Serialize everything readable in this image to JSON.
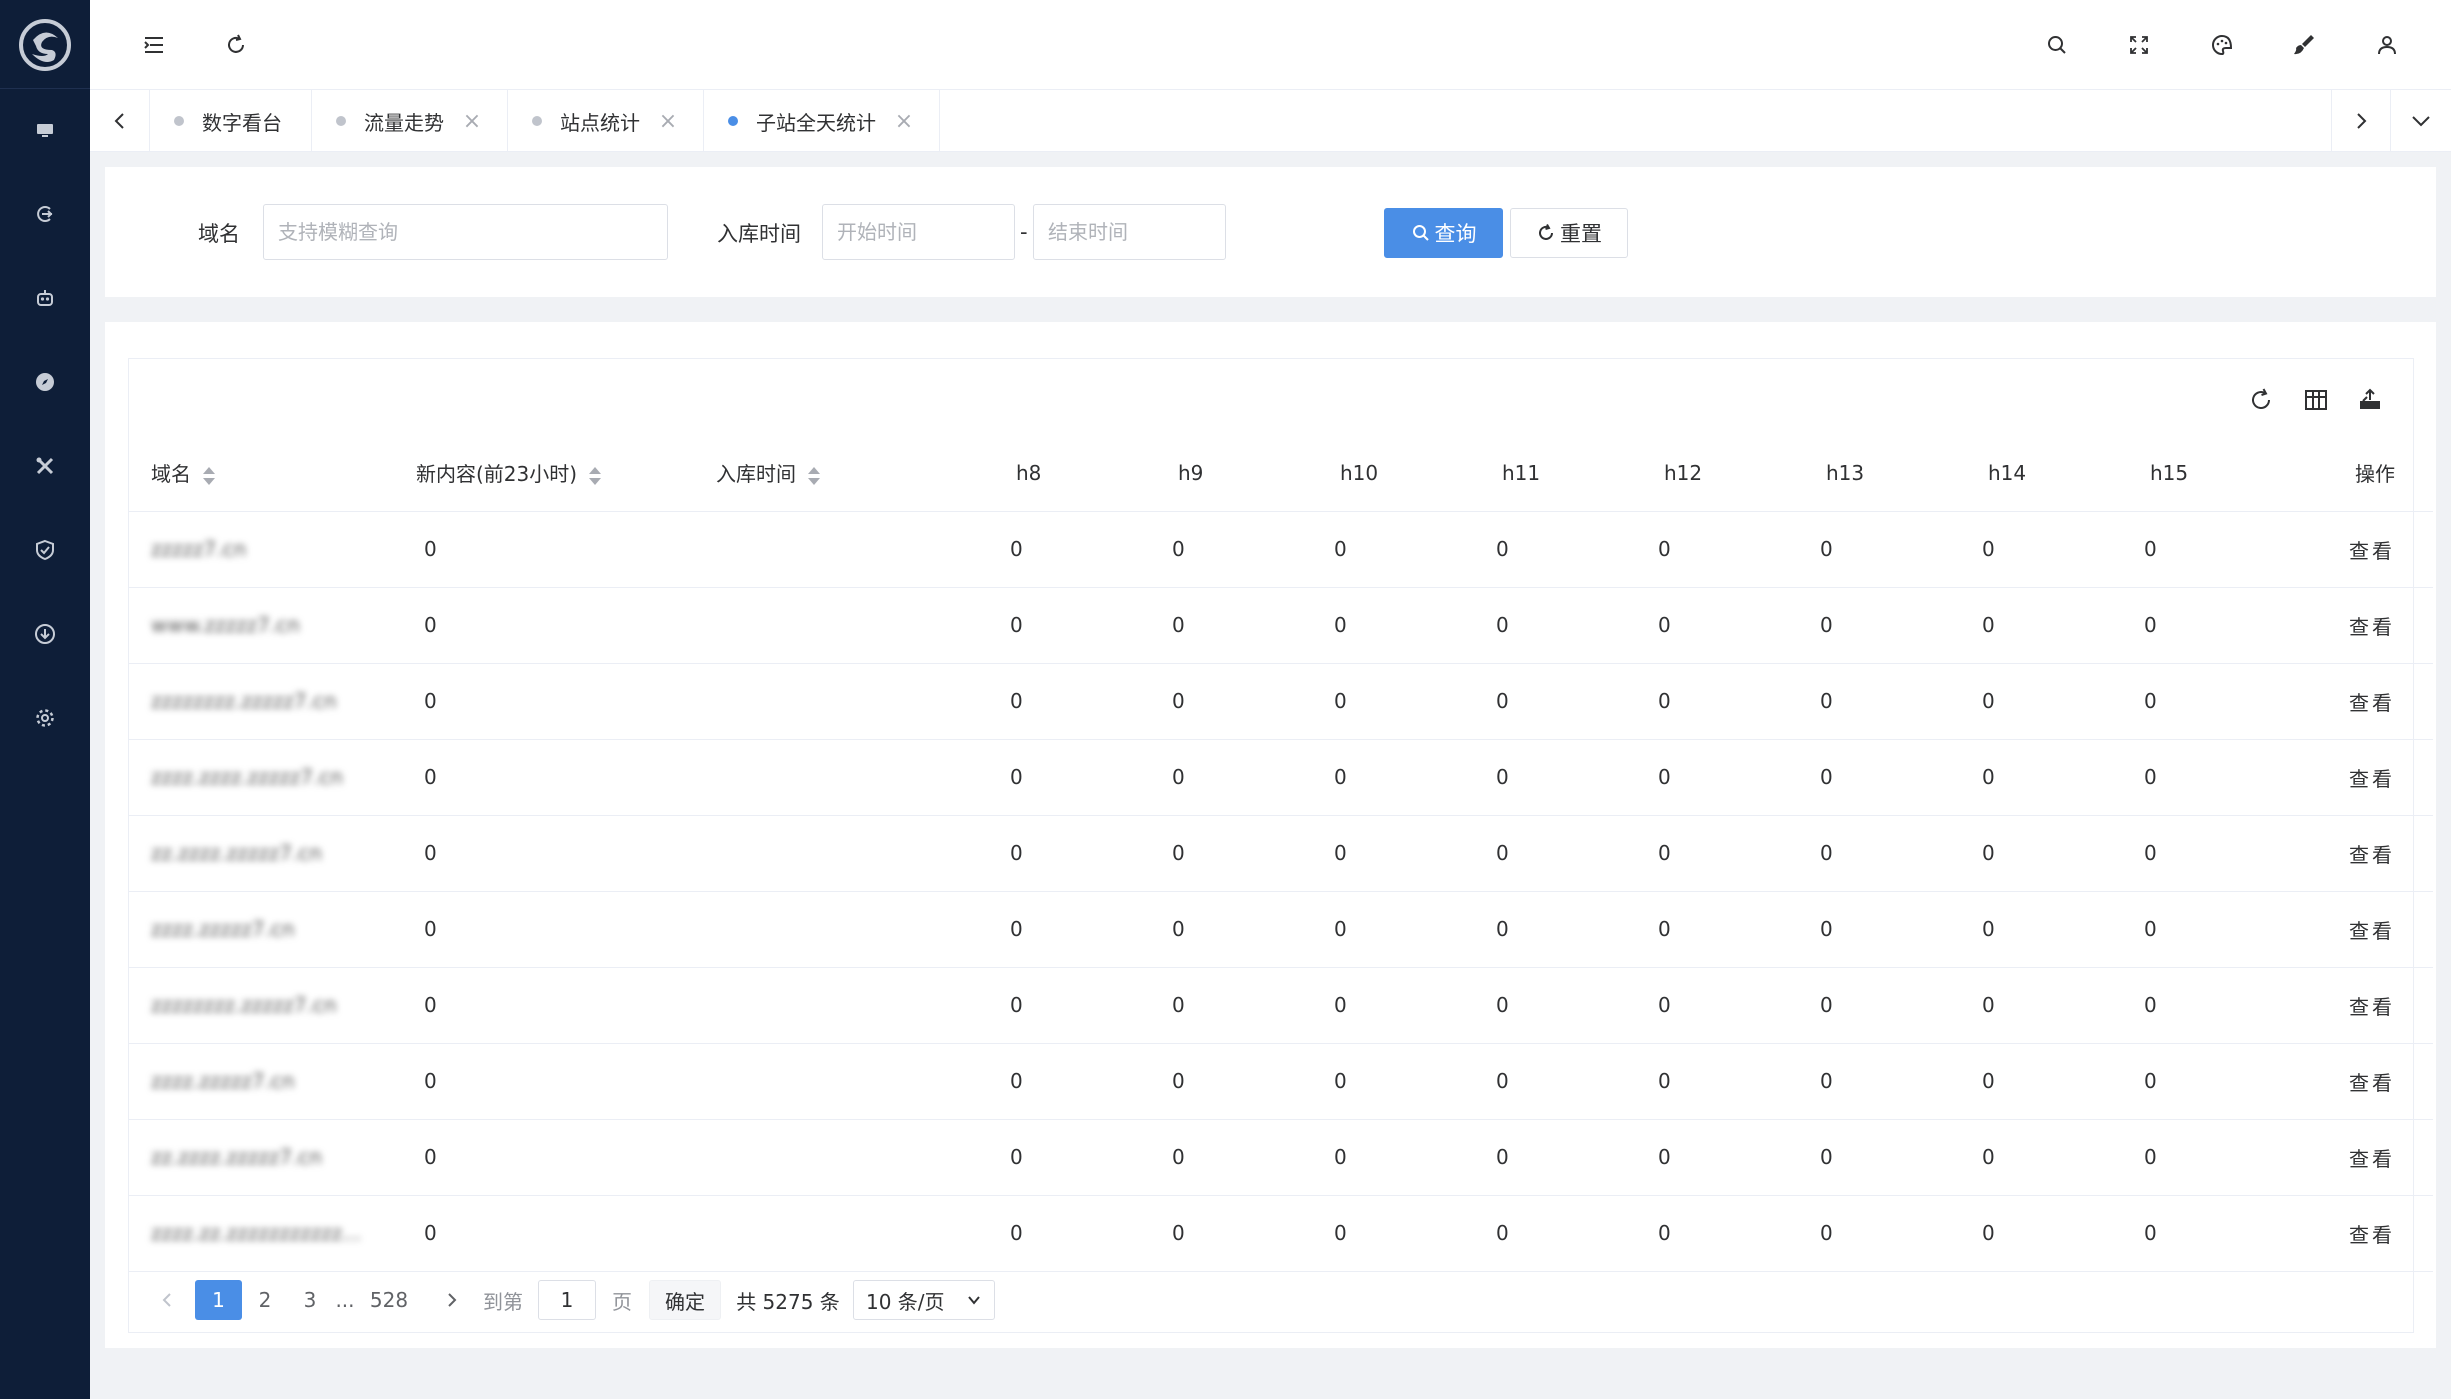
{
  "sidebar": {
    "logo": "logo-icon",
    "items": [
      {
        "name": "sidebar-item-monitor",
        "icon": "monitor-icon"
      },
      {
        "name": "sidebar-item-login",
        "icon": "login-icon"
      },
      {
        "name": "sidebar-item-robot",
        "icon": "robot-icon"
      },
      {
        "name": "sidebar-item-compass",
        "icon": "compass-icon"
      },
      {
        "name": "sidebar-item-tools",
        "icon": "tools-icon"
      },
      {
        "name": "sidebar-item-security",
        "icon": "shield-icon"
      },
      {
        "name": "sidebar-item-download",
        "icon": "download-icon"
      },
      {
        "name": "sidebar-item-settings",
        "icon": "gear-icon"
      }
    ]
  },
  "header": {
    "icons": [
      "menu-fold-icon",
      "refresh-icon",
      "search-icon",
      "fullscreen-icon",
      "palette-icon",
      "brush-icon",
      "user-icon"
    ]
  },
  "tabs": [
    {
      "label": "数字看台",
      "closable": false,
      "active": false
    },
    {
      "label": "流量走势",
      "closable": true,
      "active": false
    },
    {
      "label": "站点统计",
      "closable": true,
      "active": false
    },
    {
      "label": "子站全天统计",
      "closable": true,
      "active": true
    }
  ],
  "search": {
    "domain_label": "域名",
    "domain_placeholder": "支持模糊查询",
    "time_label": "入库时间",
    "start_placeholder": "开始时间",
    "separator": "-",
    "end_placeholder": "结束时间",
    "query_label": "查询",
    "reset_label": "重置"
  },
  "table": {
    "columns": [
      "域名",
      "新内容(前23小时)",
      "入库时间",
      "h8",
      "h9",
      "h10",
      "h11",
      "h12",
      "h13",
      "h14",
      "h15",
      "操作"
    ],
    "rows": [
      {
        "domain": "zzzzz7.cn",
        "new": "0",
        "time": "",
        "h": [
          "0",
          "0",
          "0",
          "0",
          "0",
          "0",
          "0",
          "0"
        ],
        "op": "查看"
      },
      {
        "domain": "www.zzzzz7.cn",
        "new": "0",
        "time": "",
        "h": [
          "0",
          "0",
          "0",
          "0",
          "0",
          "0",
          "0",
          "0"
        ],
        "op": "查看"
      },
      {
        "domain": "zzzzzzzz.zzzzz7.cn",
        "new": "0",
        "time": "",
        "h": [
          "0",
          "0",
          "0",
          "0",
          "0",
          "0",
          "0",
          "0"
        ],
        "op": "查看"
      },
      {
        "domain": "zzzz.zzzz.zzzzz7.cn",
        "new": "0",
        "time": "",
        "h": [
          "0",
          "0",
          "0",
          "0",
          "0",
          "0",
          "0",
          "0"
        ],
        "op": "查看"
      },
      {
        "domain": "zz.zzzz.zzzzz7.cn",
        "new": "0",
        "time": "",
        "h": [
          "0",
          "0",
          "0",
          "0",
          "0",
          "0",
          "0",
          "0"
        ],
        "op": "查看"
      },
      {
        "domain": "zzzz.zzzzz7.cn",
        "new": "0",
        "time": "",
        "h": [
          "0",
          "0",
          "0",
          "0",
          "0",
          "0",
          "0",
          "0"
        ],
        "op": "查看"
      },
      {
        "domain": "zzzzzzzz.zzzzz7.cn",
        "new": "0",
        "time": "",
        "h": [
          "0",
          "0",
          "0",
          "0",
          "0",
          "0",
          "0",
          "0"
        ],
        "op": "查看"
      },
      {
        "domain": "zzzz.zzzzz7.cn",
        "new": "0",
        "time": "",
        "h": [
          "0",
          "0",
          "0",
          "0",
          "0",
          "0",
          "0",
          "0"
        ],
        "op": "查看"
      },
      {
        "domain": "zz.zzzz.zzzzz7.cn",
        "new": "0",
        "time": "",
        "h": [
          "0",
          "0",
          "0",
          "0",
          "0",
          "0",
          "0",
          "0"
        ],
        "op": "查看"
      },
      {
        "domain": "zzzz.zz.zzzzzzzzzzz...",
        "new": "0",
        "time": "",
        "h": [
          "0",
          "0",
          "0",
          "0",
          "0",
          "0",
          "0",
          "0"
        ],
        "op": "查看"
      }
    ]
  },
  "pagination": {
    "pages": [
      "1",
      "2",
      "3"
    ],
    "ellipsis": "...",
    "last": "528",
    "goto_label": "到第",
    "goto_value": "1",
    "page_unit": "页",
    "confirm": "确定",
    "total": "共 5275 条",
    "page_size": "10 条/页"
  },
  "colors": {
    "sidebar": "#0e1e38",
    "primary": "#4a8ee6"
  }
}
